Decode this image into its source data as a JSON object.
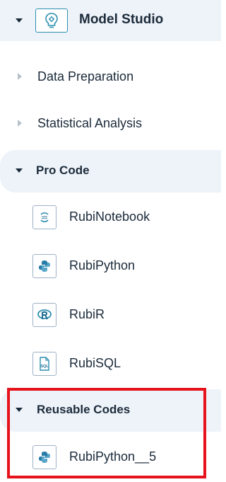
{
  "header": {
    "title": "Model Studio",
    "icon": "bulb-gear-icon"
  },
  "collapsed": [
    {
      "label": "Data Preparation"
    },
    {
      "label": "Statistical Analysis"
    }
  ],
  "pro_code": {
    "label": "Pro Code",
    "items": [
      {
        "label": "RubiNotebook",
        "icon": "notebook-icon"
      },
      {
        "label": "RubiPython",
        "icon": "python-icon"
      },
      {
        "label": "RubiR",
        "icon": "r-icon"
      },
      {
        "label": "RubiSQL",
        "icon": "sql-file-icon"
      }
    ]
  },
  "reusable": {
    "label": "Reusable Codes",
    "items": [
      {
        "label": "RubiPython__5",
        "icon": "python-icon"
      }
    ]
  },
  "sql_icon_text": "SQL",
  "colors": {
    "section_bg": "#eef3f9",
    "highlight": "#e6121c",
    "icon_accent": "#2c8fb0"
  }
}
